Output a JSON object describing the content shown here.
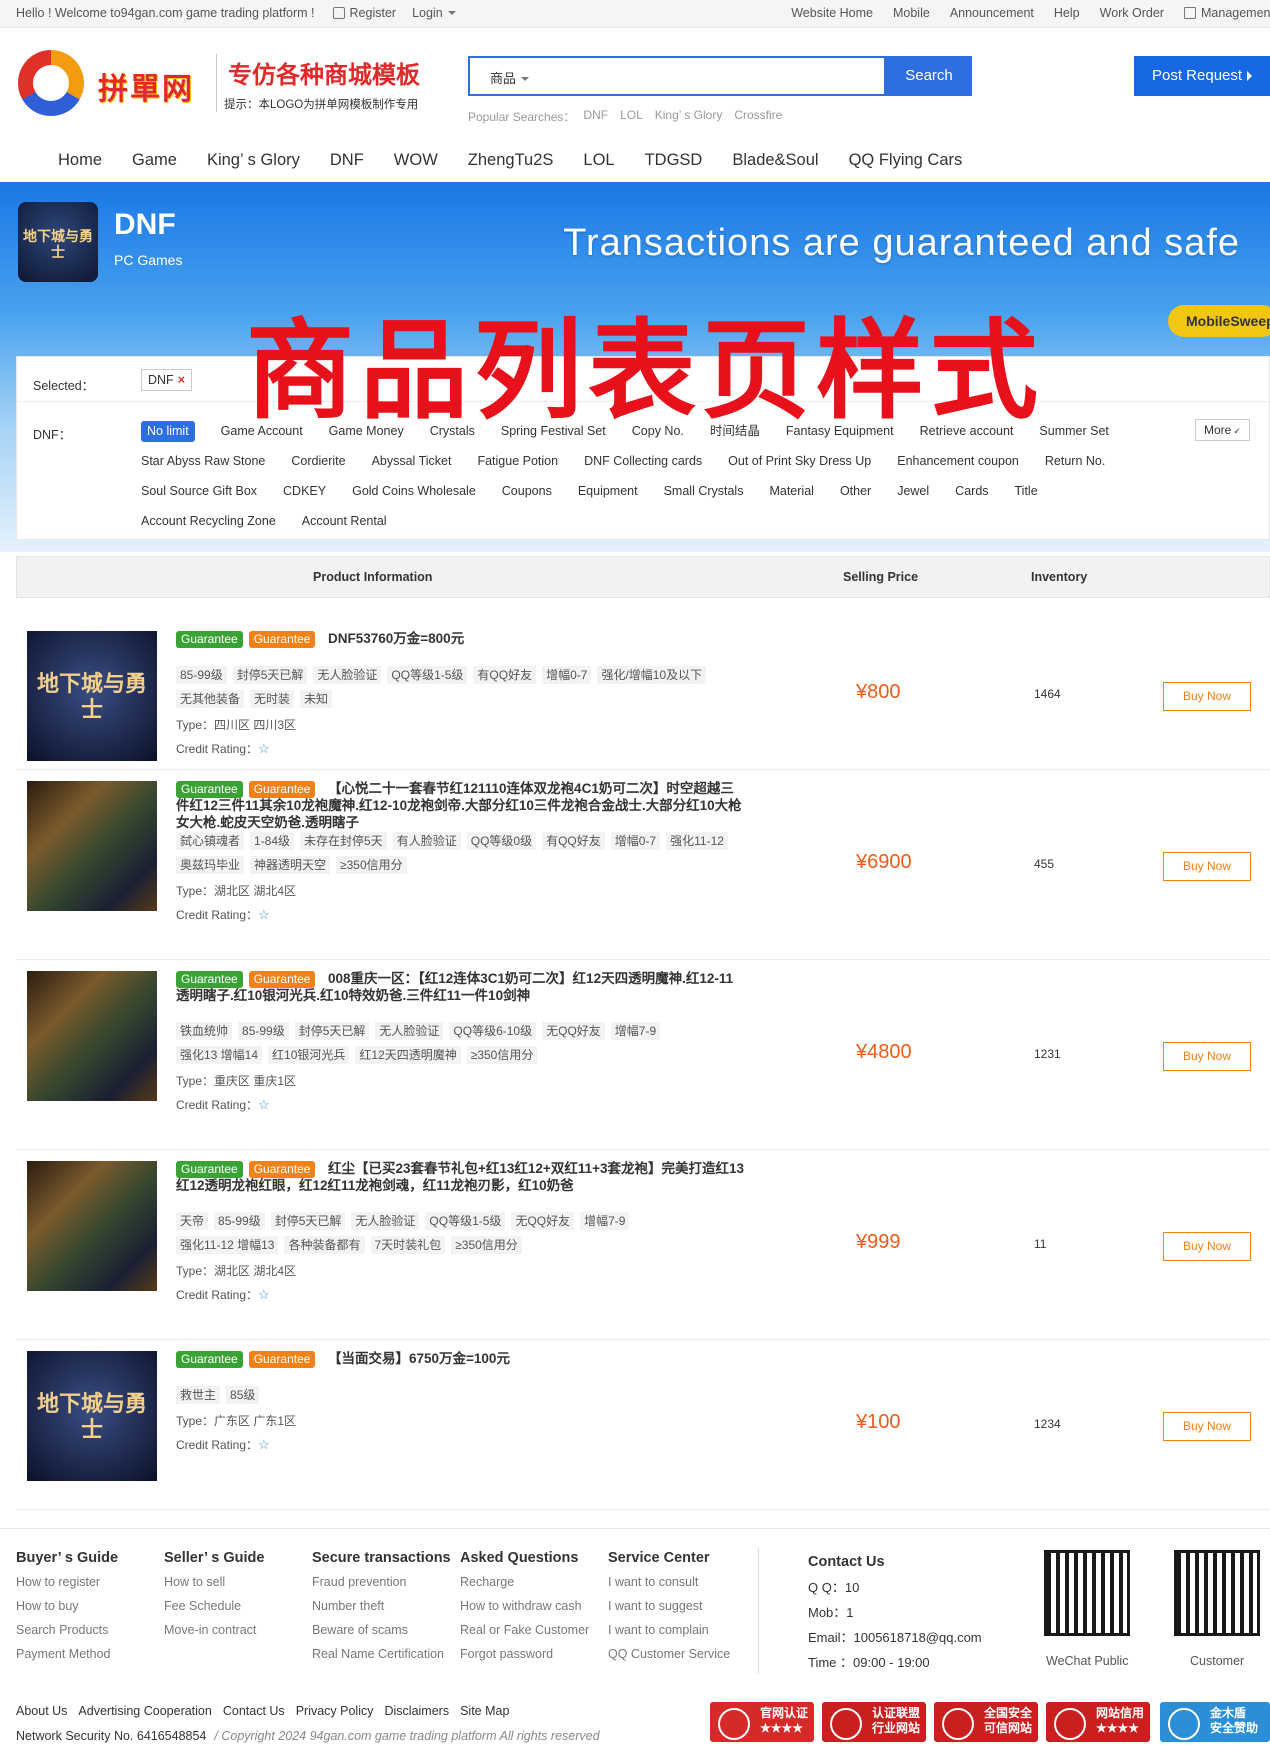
{
  "topbar": {
    "welcome": "Hello ! Welcome to94gan.com game trading platform !",
    "register": "Register",
    "login": "Login",
    "links": [
      "Website Home",
      "Mobile",
      "Announcement",
      "Help",
      "Work Order",
      "Management"
    ]
  },
  "header": {
    "logo_text": "拼單网",
    "slogan": "专仿各种商城模板",
    "tip": "提示：本LOGO为拼单网模板制作专用",
    "search_category": "商品",
    "search_placeholder": "",
    "search_button": "Search",
    "hot_label": "Popular Searches：",
    "hot_items": [
      "DNF",
      "LOL",
      "King’ s Glory",
      "Crossfire"
    ],
    "post_request": "Post Request"
  },
  "nav": [
    "Home",
    "Game",
    "King’ s Glory",
    "DNF",
    "WOW",
    "ZhengTu2S",
    "LOL",
    "TDGSD",
    "Blade&Soul",
    "QQ Flying Cars"
  ],
  "banner": {
    "game_logo_text": "地下城与勇士",
    "game_name": "DNF",
    "game_type": "PC Games",
    "slogan": "Transactions are guaranteed and safe",
    "mobile_pill": "MobileSweep",
    "overlay": "商品列表页样式"
  },
  "filter": {
    "selected_label": "Selected：",
    "selected_tag": "DNF",
    "category_label": "DNF：",
    "more": "More",
    "options": [
      "No limit",
      "Game Account",
      "Game Money",
      "Crystals",
      "Spring Festival Set",
      "Copy No.",
      "时间结晶",
      "Fantasy Equipment",
      "Retrieve account",
      "Summer Set",
      "Star Abyss Raw Stone",
      "Cordierite",
      "Abyssal Ticket",
      "Fatigue Potion",
      "DNF Collecting cards",
      "Out of Print Sky Dress Up",
      "Enhancement coupon",
      "Return No.",
      "Soul Source Gift Box",
      "CDKEY",
      "Gold Coins Wholesale",
      "Coupons",
      "Equipment",
      "Small Crystals",
      "Material",
      "Other",
      "Jewel",
      "Cards",
      "Title",
      "Account Recycling Zone",
      "Account Rental"
    ]
  },
  "table": {
    "col_product": "Product Information",
    "col_price": "Selling Price",
    "col_stock": "Inventory"
  },
  "products": [
    {
      "badge1": "Guarantee",
      "badge2": "Guarantee",
      "title": "DNF53760万金=800元",
      "tags": [
        "85-99级",
        "封停5天已解",
        "无人脸验证",
        "QQ等级1-5级",
        "有QQ好友",
        "增幅0-7",
        "强化/增幅10及以下",
        "无其他装备",
        "无时装",
        "未知"
      ],
      "type": "Type：四川区 四川3区",
      "rating": "Credit Rating：",
      "price": "¥800",
      "stock": "1464",
      "buy": "Buy Now",
      "thumb_text": "地下城与勇士"
    },
    {
      "badge1": "Guarantee",
      "badge2": "Guarantee",
      "title": "【心悦二十一套春节红121110连体双龙袍4C1奶可二次】时空超越三件红12三件11其余10龙袍魔神.红12-10龙袍剑帝.大部分红10三件龙袍合金战士.大部分红10大枪女大枪.蛇皮天空奶爸.透明瞎子",
      "tags": [
        "弑心镇魂者",
        "1-84级",
        "未存在封停5天",
        "有人脸验证",
        "QQ等级0级",
        "有QQ好友",
        "增幅0-7",
        "强化11-12",
        "奥兹玛毕业",
        "神器透明天空",
        "≥350信用分"
      ],
      "type": "Type：湖北区 湖北4区",
      "rating": "Credit Rating：",
      "price": "¥6900",
      "stock": "455",
      "buy": "Buy Now",
      "thumb_text": ""
    },
    {
      "badge1": "Guarantee",
      "badge2": "Guarantee",
      "title": "008重庆一区：【红12连体3C1奶可二次】红12天四透明魔神.红12-11透明瞎子.红10银河光兵.红10特效奶爸.三件红11一件10剑神",
      "tags": [
        "铁血统帅",
        "85-99级",
        "封停5天已解",
        "无人脸验证",
        "QQ等级6-10级",
        "无QQ好友",
        "增幅7-9",
        "强化13 增幅14",
        "红10银河光兵",
        "红12天四透明魔神",
        "≥350信用分"
      ],
      "type": "Type：重庆区 重庆1区",
      "rating": "Credit Rating：",
      "price": "¥4800",
      "stock": "1231",
      "buy": "Buy Now",
      "thumb_text": ""
    },
    {
      "badge1": "Guarantee",
      "badge2": "Guarantee",
      "title": "红尘【已买23套春节礼包+红13红12+双红11+3套龙袍】完美打造红13红12透明龙袍红眼，红12红11龙袍剑魂，红11龙袍刃影，红10奶爸",
      "tags": [
        "天帝",
        "85-99级",
        "封停5天已解",
        "无人脸验证",
        "QQ等级1-5级",
        "无QQ好友",
        "增幅7-9",
        "强化11-12 增幅13",
        "各种装备都有",
        "7天时装礼包",
        "≥350信用分"
      ],
      "type": "Type：湖北区 湖北4区",
      "rating": "Credit Rating：",
      "price": "¥999",
      "stock": "11",
      "buy": "Buy Now",
      "thumb_text": ""
    },
    {
      "badge1": "Guarantee",
      "badge2": "Guarantee",
      "title": "【当面交易】6750万金=100元",
      "tags": [
        "救世主",
        "85级"
      ],
      "type": "Type：广东区 广东1区",
      "rating": "Credit Rating：",
      "price": "¥100",
      "stock": "1234",
      "buy": "Buy Now",
      "thumb_text": "地下城与勇士"
    }
  ],
  "footer": {
    "cols": [
      {
        "title": "Buyer’ s Guide",
        "items": [
          "How to register",
          "How to buy",
          "Search Products",
          "Payment Method"
        ]
      },
      {
        "title": "Seller’ s Guide",
        "items": [
          "How to sell",
          "Fee Schedule",
          "Move-in contract"
        ]
      },
      {
        "title": "Secure transactions",
        "items": [
          "Fraud prevention",
          "Number theft",
          "Beware of scams",
          "Real Name Certification"
        ]
      },
      {
        "title": "Asked Questions",
        "items": [
          "Recharge",
          "How to withdraw cash",
          "Real or Fake Customer",
          "Forgot password"
        ]
      },
      {
        "title": "Service Center",
        "items": [
          "I want to consult",
          "I want to suggest",
          "I want to complain",
          "QQ Customer Service"
        ]
      }
    ],
    "contact_title": "Contact Us",
    "qq": "Q Q：10",
    "mobile": "Mob：1",
    "email": "Email：1005618718@qq.com",
    "time": "Time ：09:00 - 19:00",
    "qr1": "WeChat Public",
    "qr2": "Customer",
    "bottom_links": [
      "About Us",
      "Advertising Cooperation",
      "Contact Us",
      "Privacy Policy",
      "Disclaimers",
      "Site Map"
    ],
    "security_no": "Network Security No. 6416548854",
    "copyright": "/  Copyright 2024 94gan.com game trading platform All rights reserved",
    "certs": [
      {
        "line1": "官网认证",
        "line2": "★★★★",
        "color": "#d42a28"
      },
      {
        "line1": "认证联盟",
        "line2": "行业网站",
        "color": "#c8201f"
      },
      {
        "line1": "全国安全",
        "line2": "可信网站",
        "color": "#c8201f"
      },
      {
        "line1": "网站信用",
        "line2": "★★★★",
        "color": "#c8201f"
      },
      {
        "line1": "金木盾",
        "line2": "安全赞助",
        "color": "#2b8fd8"
      }
    ]
  }
}
